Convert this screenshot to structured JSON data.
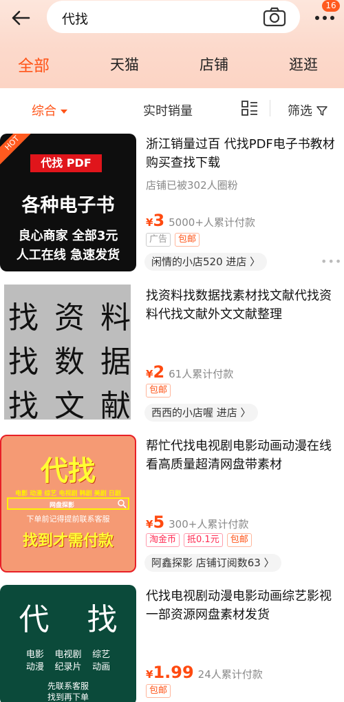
{
  "header": {
    "search_query": "代找",
    "badge_count": "16",
    "tabs": [
      {
        "label": "全部"
      },
      {
        "label": "天猫"
      },
      {
        "label": "店铺"
      },
      {
        "label": "逛逛"
      }
    ]
  },
  "sortbar": {
    "composite": "综合",
    "realtime_sales": "实时销量",
    "filter": "筛选"
  },
  "items": [
    {
      "title": "浙江销量过百 代找PDF电子书教材购买查找下载",
      "subtitle": "店铺已被302人圈粉",
      "price_symbol": "¥",
      "price": "3",
      "sales": "5000+人累计付款",
      "tags": [
        "广告",
        "包邮"
      ],
      "shop": "闲情的小店520 进店 〉",
      "thumb": {
        "hot": "HOT",
        "badge": "代找 PDF",
        "line1": "各种电子书",
        "line2": "良心商家 全部3元",
        "line3": "人工在线 急速发货"
      }
    },
    {
      "title": "找资料找数据找素材找文献代找资料代找文献外文文献整理",
      "price_symbol": "¥",
      "price": "2",
      "sales": "61人累计付款",
      "tags": [
        "包邮"
      ],
      "shop": "西西的小店喔 进店 〉",
      "thumb": {
        "row1": [
          "找",
          "资",
          "料"
        ],
        "row2": [
          "找",
          "数",
          "据"
        ],
        "row3": [
          "找",
          "文",
          "献"
        ]
      }
    },
    {
      "title": "帮忙代找电视剧电影动画动漫在线看高质量超清网盘带素材",
      "price_symbol": "¥",
      "price": "5",
      "sales": "300+人累计付款",
      "tags": [
        "淘金币",
        "抵0.1元",
        "包邮"
      ],
      "shop": "阿鑫探影 店铺订阅数63 〉",
      "thumb": {
        "big": "代找",
        "cats": "电影 动漫 综艺 电视剧 韩剧 美剧 日剧",
        "bar": "网盘探影",
        "small": "下单前记得提前联系客服",
        "bottom": "找到才需付款"
      }
    },
    {
      "title": "代找电视剧动漫电影动画综艺影视一部资源网盘素材发货",
      "price_symbol": "¥",
      "price": "1.99",
      "sales": "24人累计付款",
      "tags": [
        "包邮"
      ],
      "thumb": {
        "big1": "代",
        "big2": "找",
        "row1": [
          "电影",
          "电视剧",
          "综艺"
        ],
        "row2": [
          "动漫",
          "纪录片",
          "动画"
        ],
        "foot1": "先联系客服",
        "foot2": "找到再下单"
      }
    }
  ]
}
